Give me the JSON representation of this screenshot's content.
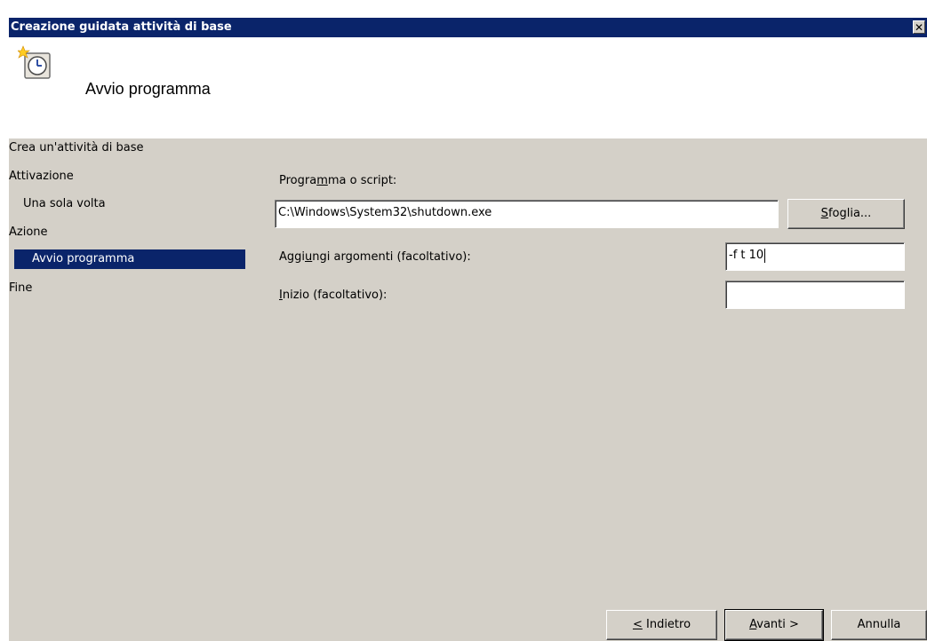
{
  "window": {
    "title": "Creazione guidata attività di base",
    "close_symbol": "✕"
  },
  "header": {
    "title": "Avvio programma",
    "icon": "scheduled-task-clock-icon"
  },
  "nav": {
    "items": [
      {
        "label": "Crea un'attività di base",
        "selected": false
      },
      {
        "label": "Attivazione",
        "selected": false
      },
      {
        "label": "Una sola volta",
        "selected": false
      },
      {
        "label": "Azione",
        "selected": false
      },
      {
        "label": "Avvio programma",
        "selected": true
      },
      {
        "label": "Fine",
        "selected": false
      }
    ]
  },
  "form": {
    "program_label": {
      "pre": "Progra",
      "mn": "m",
      "post": "ma o script:"
    },
    "program_value": "C:\\Windows\\System32\\shutdown.exe",
    "browse_button": {
      "mn": "S",
      "post": "foglia..."
    },
    "args_label": {
      "pre": "Aggi",
      "mn": "u",
      "post": "ngi argomenti (facoltativo):"
    },
    "args_value": "-f t 10",
    "start_label": {
      "mn": "I",
      "post": "nizio (facoltativo):"
    },
    "start_value": ""
  },
  "buttons": {
    "back": {
      "mn": "<",
      "post": " Indietro"
    },
    "next": {
      "mn": "A",
      "post": "vanti >"
    },
    "cancel": "Annulla"
  },
  "colors": {
    "titlebar": "#0a246a",
    "dialog": "#d4d0c8",
    "selection": "#0a246a"
  }
}
